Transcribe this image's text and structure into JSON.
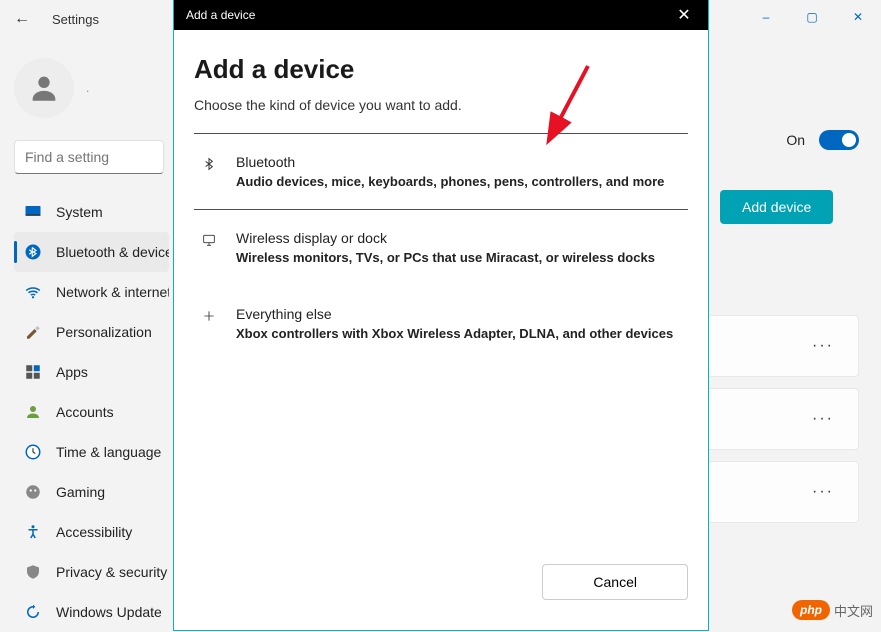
{
  "window": {
    "title": "Settings",
    "bluetooth_toggle_label": "On"
  },
  "search": {
    "placeholder": "Find a setting"
  },
  "user": {
    "label": "."
  },
  "sidebar": {
    "items": [
      {
        "label": "System"
      },
      {
        "label": "Bluetooth & devices"
      },
      {
        "label": "Network & internet"
      },
      {
        "label": "Personalization"
      },
      {
        "label": "Apps"
      },
      {
        "label": "Accounts"
      },
      {
        "label": "Time & language"
      },
      {
        "label": "Gaming"
      },
      {
        "label": "Accessibility"
      },
      {
        "label": "Privacy & security"
      },
      {
        "label": "Windows Update"
      }
    ]
  },
  "main": {
    "add_device_button": "Add device",
    "more_label": "···"
  },
  "modal": {
    "titlebar": "Add a device",
    "heading": "Add a device",
    "subtitle": "Choose the kind of device you want to add.",
    "options": [
      {
        "title": "Bluetooth",
        "desc": "Audio devices, mice, keyboards, phones, pens, controllers, and more"
      },
      {
        "title": "Wireless display or dock",
        "desc": "Wireless monitors, TVs, or PCs that use Miracast, or wireless docks"
      },
      {
        "title": "Everything else",
        "desc": "Xbox controllers with Xbox Wireless Adapter, DLNA, and other devices"
      }
    ],
    "cancel": "Cancel"
  },
  "watermark": {
    "badge": "php",
    "text": "中文网"
  }
}
